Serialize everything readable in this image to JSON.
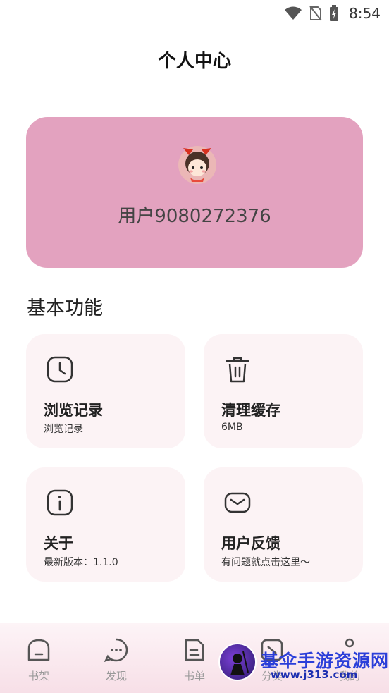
{
  "status_bar": {
    "time": "8:54"
  },
  "page": {
    "title": "个人中心"
  },
  "profile": {
    "username": "用户9080272376"
  },
  "section": {
    "title": "基本功能"
  },
  "tiles": [
    {
      "icon": "clock-icon",
      "title": "浏览记录",
      "subtitle": "浏览记录"
    },
    {
      "icon": "trash-icon",
      "title": "清理缓存",
      "subtitle": "6MB"
    },
    {
      "icon": "info-icon",
      "title": "关于",
      "subtitle": "最新版本：1.1.0"
    },
    {
      "icon": "mail-icon",
      "title": "用户反馈",
      "subtitle": "有问题就点击这里～"
    }
  ],
  "nav": [
    {
      "icon": "bookshelf-icon",
      "label": "书架"
    },
    {
      "icon": "discover-icon",
      "label": "发现"
    },
    {
      "icon": "booklist-icon",
      "label": "书单"
    },
    {
      "icon": "category-icon",
      "label": "分类"
    },
    {
      "icon": "profile-icon",
      "label": "我的"
    }
  ],
  "watermark": {
    "text": "基伞手游资源网",
    "url": "www.j313.com"
  },
  "colors": {
    "card": "#e3a2bf",
    "tile": "#fcf3f5",
    "nav_label": "#9a9a9a"
  }
}
